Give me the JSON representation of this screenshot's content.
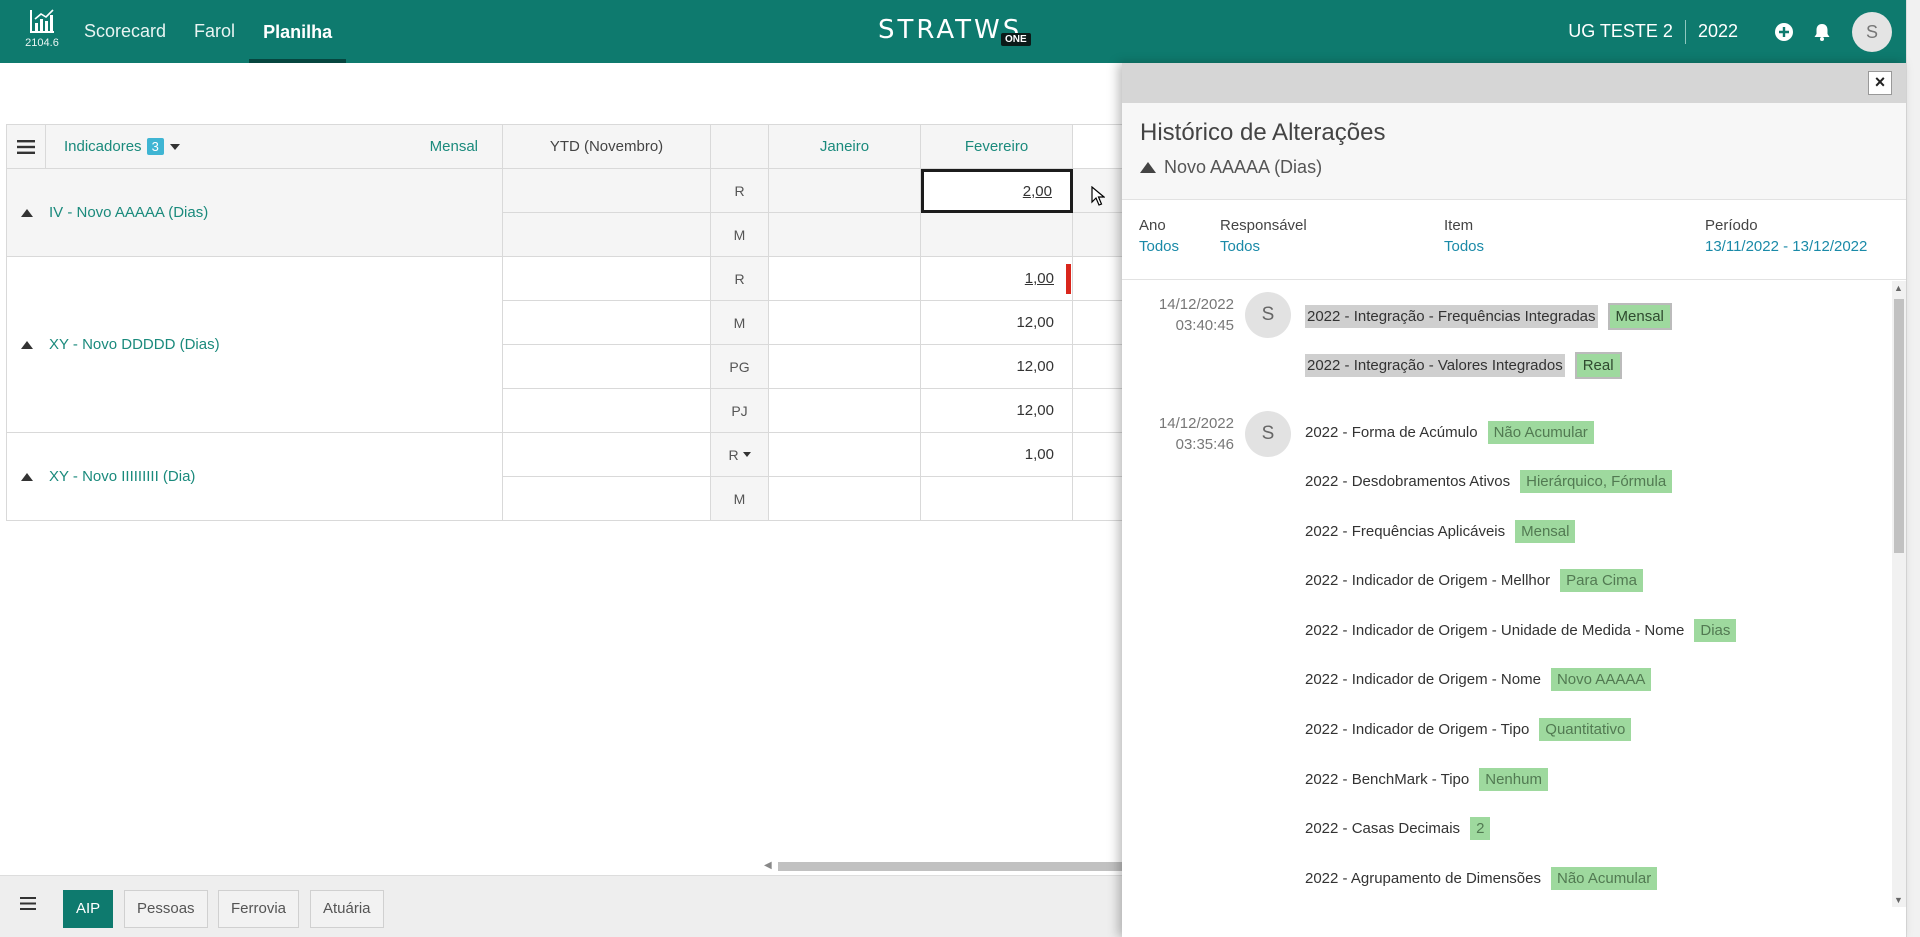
{
  "topbar": {
    "version": "2104.6",
    "nav": [
      "Scorecard",
      "Farol",
      "Planilha"
    ],
    "brand": "STRATWS",
    "brand_badge": "ONE",
    "unit": "UG TESTE 2",
    "year": "2022",
    "avatar": "S",
    "color": "#0e7a6e"
  },
  "grid": {
    "indicators_label": "Indicadores",
    "indicators_count": "3",
    "frequency": "Mensal",
    "ytd": "YTD (Novembro)",
    "months": [
      "Janeiro",
      "Fevereiro"
    ],
    "rows": [
      {
        "label": "IV - Novo AAAAA (Dias)",
        "lines": [
          {
            "type": "R",
            "fev": "2,00"
          },
          {
            "type": "M",
            "fev": ""
          }
        ]
      },
      {
        "label": "XY - Novo DDDDD (Dias)",
        "lines": [
          {
            "type": "R",
            "fev": "1,00"
          },
          {
            "type": "M",
            "fev": "12,00"
          },
          {
            "type": "PG",
            "fev": "12,00"
          },
          {
            "type": "PJ",
            "fev": "12,00"
          }
        ]
      },
      {
        "label": "XY - Novo IIIIIIIII (Dia)",
        "lines": [
          {
            "type": "R",
            "fev": "1,00"
          },
          {
            "type": "M",
            "fev": ""
          }
        ]
      }
    ]
  },
  "bottom_tabs": [
    "AIP",
    "Pessoas",
    "Ferrovia",
    "Atuária"
  ],
  "panel": {
    "title": "Histórico de Alterações",
    "subtitle": "Novo AAAAA (Dias)",
    "filters": {
      "ano": {
        "label": "Ano",
        "value": "Todos"
      },
      "responsavel": {
        "label": "Responsável",
        "value": "Todos"
      },
      "item": {
        "label": "Item",
        "value": "Todos"
      },
      "periodo": {
        "label": "Período",
        "value": "13/11/2022 - 13/12/2022"
      }
    },
    "entries": [
      {
        "date": "14/12/2022",
        "time": "03:40:45",
        "user": "S",
        "changes": [
          {
            "key": "2022 - Integração - Frequências Integradas",
            "value": "Mensal"
          },
          {
            "key": "2022 - Integração - Valores Integrados",
            "value": "Real"
          }
        ]
      },
      {
        "date": "14/12/2022",
        "time": "03:35:46",
        "user": "S",
        "changes": [
          {
            "key": "2022 - Forma de Acúmulo",
            "value": "Não Acumular"
          },
          {
            "key": "2022 - Desdobramentos Ativos",
            "value": "Hierárquico, Fórmula"
          },
          {
            "key": "2022 - Frequências Aplicáveis",
            "value": "Mensal"
          },
          {
            "key": "2022 - Indicador de Origem - Mellhor",
            "value": "Para Cima"
          },
          {
            "key": "2022 - Indicador de Origem - Unidade de Medida - Nome",
            "value": "Dias"
          },
          {
            "key": "2022 - Indicador de Origem - Nome",
            "value": "Novo AAAAA"
          },
          {
            "key": "2022 - Indicador de Origem - Tipo",
            "value": "Quantitativo"
          },
          {
            "key": "2022 - BenchMark - Tipo",
            "value": "Nenhum"
          },
          {
            "key": "2022 - Casas Decimais",
            "value": "2"
          },
          {
            "key": "2022 - Agrupamento de Dimensões",
            "value": "Não Acumular"
          }
        ]
      }
    ]
  }
}
